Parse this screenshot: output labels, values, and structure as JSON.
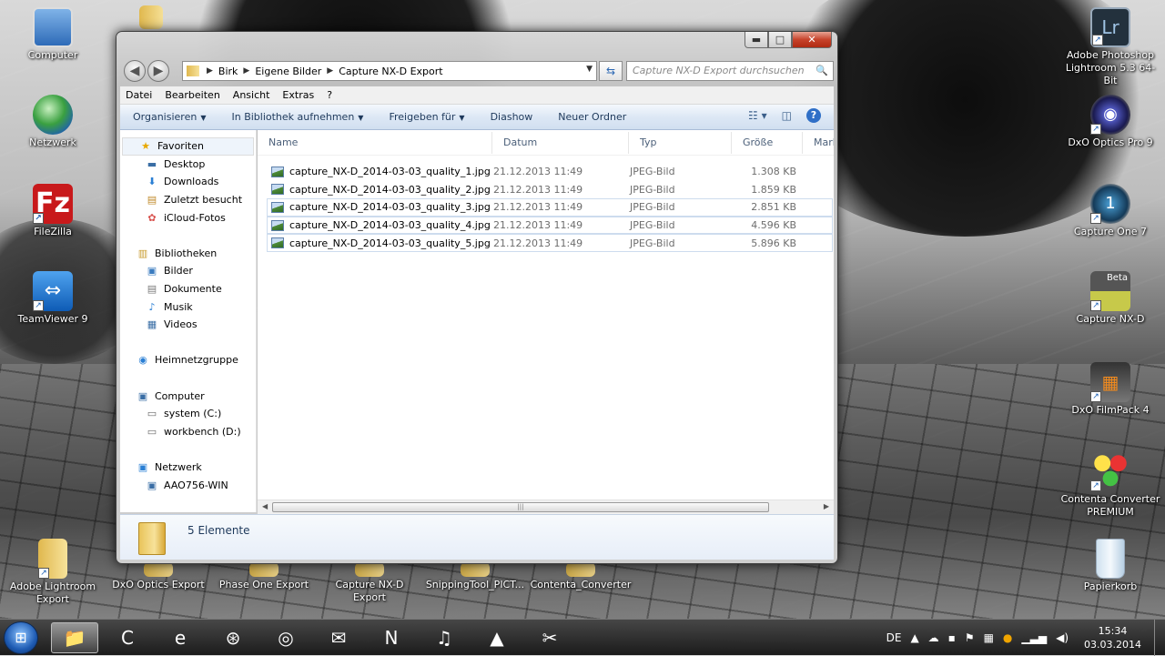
{
  "desktop": {
    "left_icons": [
      {
        "label": "Computer",
        "icon": "computer-icon"
      },
      {
        "label": "Netzwerk",
        "icon": "network-globe-icon"
      },
      {
        "label": "FileZilla",
        "icon": "filezilla-icon"
      },
      {
        "label": "TeamViewer 9",
        "icon": "teamviewer-icon"
      }
    ],
    "right_icons": [
      {
        "label": "Adobe Photoshop Lightroom 5.3 64-Bit",
        "icon": "lightroom-icon",
        "glyph": "Lr"
      },
      {
        "label": "DxO Optics Pro 9",
        "icon": "dxo-optics-icon",
        "glyph": "◉"
      },
      {
        "label": "Capture One 7",
        "icon": "capture-one-icon",
        "glyph": "1"
      },
      {
        "label": "Capture NX-D",
        "icon": "capture-nxd-icon",
        "glyph": "Beta"
      },
      {
        "label": "DxO FilmPack 4",
        "icon": "dxo-filmpack-icon",
        "glyph": "▦"
      },
      {
        "label": "Contenta Converter PREMIUM",
        "icon": "contenta-converter-icon",
        "glyph": "●"
      },
      {
        "label": "Papierkorb",
        "icon": "recycle-bin-icon",
        "glyph": "🗑"
      }
    ],
    "bottom_icons": [
      {
        "label": "Adobe Lightroom Export"
      },
      {
        "label": "DxO Optics Export"
      },
      {
        "label": "Phase One Export"
      },
      {
        "label": "Capture NX-D Export"
      },
      {
        "label": "SnippingTool_PICT..."
      },
      {
        "label": "Contenta_Converter"
      }
    ]
  },
  "window": {
    "caption_buttons": {
      "minimize": "▬",
      "maximize": "□",
      "close": "✕"
    },
    "nav": {
      "back": "◀",
      "forward": "▶"
    },
    "address": {
      "crumbs": [
        "Birk",
        "Eigene Bilder",
        "Capture NX-D Export"
      ],
      "separator": "▶"
    },
    "search": {
      "placeholder": "Capture NX-D Export durchsuchen",
      "icon": "🔍"
    },
    "menu": [
      "Datei",
      "Bearbeiten",
      "Ansicht",
      "Extras",
      "?"
    ],
    "commands": [
      {
        "label": "Organisieren",
        "dropdown": true
      },
      {
        "label": "In Bibliothek aufnehmen",
        "dropdown": true
      },
      {
        "label": "Freigeben für",
        "dropdown": true
      },
      {
        "label": "Diashow",
        "dropdown": false
      },
      {
        "label": "Neuer Ordner",
        "dropdown": false
      }
    ],
    "nav_pane": [
      {
        "label": "Favoriten",
        "level": 0,
        "icon": "star-icon",
        "glyph": "★",
        "color": "#e8a800",
        "selected": true
      },
      {
        "label": "Desktop",
        "level": 1,
        "icon": "desktop-icon",
        "glyph": "▬",
        "color": "#3a6ea5"
      },
      {
        "label": "Downloads",
        "level": 1,
        "icon": "downloads-icon",
        "glyph": "⬇",
        "color": "#2a7fd4"
      },
      {
        "label": "Zuletzt besucht",
        "level": 1,
        "icon": "recent-places-icon",
        "glyph": "▤",
        "color": "#c08a2a"
      },
      {
        "label": "iCloud-Fotos",
        "level": 1,
        "icon": "icloud-photos-icon",
        "glyph": "✿",
        "color": "#d9534f"
      },
      {
        "gap": true
      },
      {
        "label": "Bibliotheken",
        "level": 0,
        "icon": "libraries-icon",
        "glyph": "▥",
        "color": "#c89b2e"
      },
      {
        "label": "Bilder",
        "level": 1,
        "icon": "pictures-icon",
        "glyph": "▣",
        "color": "#3a7bbf"
      },
      {
        "label": "Dokumente",
        "level": 1,
        "icon": "documents-icon",
        "glyph": "▤",
        "color": "#7a7a7a"
      },
      {
        "label": "Musik",
        "level": 1,
        "icon": "music-icon",
        "glyph": "♪",
        "color": "#2a7fd4"
      },
      {
        "label": "Videos",
        "level": 1,
        "icon": "videos-icon",
        "glyph": "▦",
        "color": "#3a6ea5"
      },
      {
        "gap": true
      },
      {
        "label": "Heimnetzgruppe",
        "level": 0,
        "icon": "homegroup-icon",
        "glyph": "◉",
        "color": "#2a7fd4"
      },
      {
        "gap": true
      },
      {
        "label": "Computer",
        "level": 0,
        "icon": "computer-icon",
        "glyph": "▣",
        "color": "#3a6ea5"
      },
      {
        "label": "system (C:)",
        "level": 1,
        "icon": "drive-c-icon",
        "glyph": "▭",
        "color": "#6a6a6a"
      },
      {
        "label": "workbench (D:)",
        "level": 1,
        "icon": "drive-d-icon",
        "glyph": "▭",
        "color": "#6a6a6a"
      },
      {
        "gap": true
      },
      {
        "label": "Netzwerk",
        "level": 0,
        "icon": "network-icon",
        "glyph": "▣",
        "color": "#2a7fd4"
      },
      {
        "label": "AAO756-WIN",
        "level": 1,
        "icon": "network-computer-icon",
        "glyph": "▣",
        "color": "#3a6ea5"
      }
    ],
    "columns": [
      "Name",
      "Datum",
      "Typ",
      "Größe",
      "Marki"
    ],
    "files": [
      {
        "name": "capture_NX-D_2014-03-03_quality_1.jpg",
        "date": "21.12.2013 11:49",
        "type": "JPEG-Bild",
        "size": "1.308 KB",
        "selected": false
      },
      {
        "name": "capture_NX-D_2014-03-03_quality_2.jpg",
        "date": "21.12.2013 11:49",
        "type": "JPEG-Bild",
        "size": "1.859 KB",
        "selected": false
      },
      {
        "name": "capture_NX-D_2014-03-03_quality_3.jpg",
        "date": "21.12.2013 11:49",
        "type": "JPEG-Bild",
        "size": "2.851 KB",
        "selected": true
      },
      {
        "name": "capture_NX-D_2014-03-03_quality_4.jpg",
        "date": "21.12.2013 11:49",
        "type": "JPEG-Bild",
        "size": "4.596 KB",
        "selected": true
      },
      {
        "name": "capture_NX-D_2014-03-03_quality_5.jpg",
        "date": "21.12.2013 11:49",
        "type": "JPEG-Bild",
        "size": "5.896 KB",
        "selected": true
      }
    ],
    "status": {
      "item_count": "5 Elemente"
    }
  },
  "taskbar": {
    "pinned": [
      {
        "name": "explorer-taskbar-button",
        "glyph": "📁",
        "active": true
      },
      {
        "name": "capture-nxd-taskbar-button",
        "glyph": "C",
        "active": false
      },
      {
        "name": "internet-explorer-taskbar-button",
        "glyph": "e",
        "active": false
      },
      {
        "name": "safari-taskbar-button",
        "glyph": "⊛",
        "active": false
      },
      {
        "name": "chrome-taskbar-button",
        "glyph": "◎",
        "active": false
      },
      {
        "name": "thunderbird-taskbar-button",
        "glyph": "✉",
        "active": false
      },
      {
        "name": "onenote-taskbar-button",
        "glyph": "N",
        "active": false
      },
      {
        "name": "itunes-taskbar-button",
        "glyph": "♫",
        "active": false
      },
      {
        "name": "vlc-taskbar-button",
        "glyph": "▲",
        "active": false
      },
      {
        "name": "snipping-tool-taskbar-button",
        "glyph": "✂",
        "active": false
      }
    ],
    "tray": {
      "language": "DE",
      "time": "15:34",
      "date": "03.03.2014"
    }
  },
  "colors": {
    "accent": "#1e395b",
    "close": "#c7432b",
    "selection": "#cddcee"
  }
}
